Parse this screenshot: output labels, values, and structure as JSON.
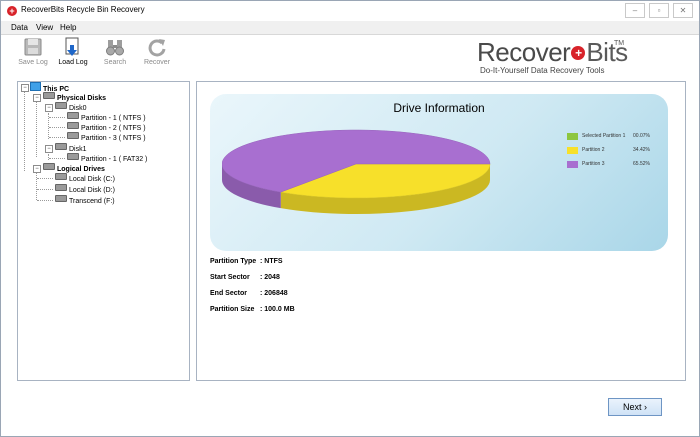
{
  "window": {
    "title": "RecoverBits Recycle Bin Recovery",
    "controls": [
      "–",
      "▫",
      "✕"
    ]
  },
  "menu": [
    "Data",
    "View",
    "Help"
  ],
  "toolbar": {
    "save_log": "Save Log",
    "load_log": "Load Log",
    "search": "Search",
    "recover": "Recover"
  },
  "logo": {
    "main_a": "Recover",
    "main_b": "Bits",
    "tm": "TM",
    "tagline": "Do-It-Yourself Data Recovery Tools"
  },
  "tree": {
    "root": "This PC",
    "physical": "Physical Disks",
    "disk0": "Disk0",
    "disk0_parts": [
      "Partition - 1 ( NTFS )",
      "Partition - 2 ( NTFS )",
      "Partition - 3 ( NTFS )"
    ],
    "disk1": "Disk1",
    "disk1_parts": [
      "Partition - 1 ( FAT32 )"
    ],
    "logical": "Logical Drives",
    "drives": [
      "Local Disk (C:)",
      "Local Disk (D:)",
      "Transcend (F:)"
    ]
  },
  "drive_info": {
    "title": "Drive Information",
    "legend": [
      {
        "label": "Selected Partition 1",
        "value": "00.07%",
        "color": "#8dc63f"
      },
      {
        "label": "Partition 2",
        "value": "34.42%",
        "color": "#f7e02a"
      },
      {
        "label": "Partition 3",
        "value": "65.52%",
        "color": "#a86fd0"
      }
    ]
  },
  "chart_data": {
    "type": "pie",
    "title": "Drive Information",
    "categories": [
      "Selected Partition 1",
      "Partition 2",
      "Partition 3"
    ],
    "values": [
      0.07,
      34.42,
      65.52
    ],
    "colors": [
      "#8dc63f",
      "#f7e02a",
      "#a86fd0"
    ],
    "legend_position": "right"
  },
  "details": [
    {
      "label": "Partition Type",
      "value": ": NTFS"
    },
    {
      "label": "Start Sector",
      "value": ": 2048"
    },
    {
      "label": "End Sector",
      "value": ": 206848"
    },
    {
      "label": "Partition Size",
      "value": ": 100.0 MB"
    }
  ],
  "next_label": "Next"
}
